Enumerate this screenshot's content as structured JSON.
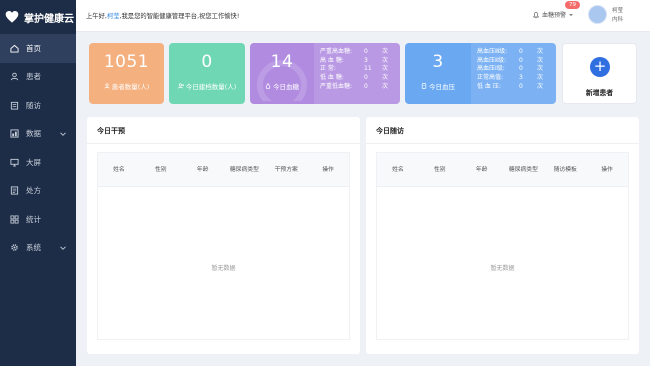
{
  "app": {
    "title": "掌护健康云"
  },
  "sidebar": {
    "items": [
      {
        "label": "首页",
        "icon": "home-icon",
        "expandable": false
      },
      {
        "label": "患者",
        "icon": "user-icon",
        "expandable": false
      },
      {
        "label": "随访",
        "icon": "clipboard-icon",
        "expandable": false
      },
      {
        "label": "数据",
        "icon": "data-icon",
        "expandable": true
      },
      {
        "label": "大屏",
        "icon": "monitor-icon",
        "expandable": false
      },
      {
        "label": "处方",
        "icon": "document-icon",
        "expandable": false
      },
      {
        "label": "统计",
        "icon": "grid-icon",
        "expandable": false
      },
      {
        "label": "系统",
        "icon": "gear-icon",
        "expandable": true
      }
    ],
    "active_index": 0
  },
  "header": {
    "greeting_prefix": "上午好,",
    "user_name": "柯莹",
    "greeting_suffix": ",我是您的智能健康管理平台,祝您工作愉快!",
    "alert_label": "血糖预警",
    "alert_count": "79",
    "user_short": "柯莹",
    "department": "内科"
  },
  "cards": {
    "patients": {
      "value": "1051",
      "label": "患者数量(人)",
      "color": "#f5b07f"
    },
    "archived_today": {
      "value": "0",
      "label": "今日建档数量(人)",
      "color": "#6fd7b4"
    },
    "glucose_today": {
      "value": "14",
      "label": "今日血糖",
      "color": "#b08be0",
      "stats": [
        {
          "label": "严重高血糖:",
          "value": "0",
          "unit": "次"
        },
        {
          "label": "高 血 糖:",
          "value": "3",
          "unit": "次"
        },
        {
          "label": "正 常:",
          "value": "11",
          "unit": "次"
        },
        {
          "label": "低 血 糖:",
          "value": "0",
          "unit": "次"
        },
        {
          "label": "严重低血糖:",
          "value": "0",
          "unit": "次"
        }
      ]
    },
    "bp_today": {
      "value": "3",
      "label": "今日血压",
      "color": "#6aa8f2",
      "stats": [
        {
          "label": "高血压Ⅲ级:",
          "value": "0",
          "unit": "次"
        },
        {
          "label": "高血压Ⅱ级:",
          "value": "0",
          "unit": "次"
        },
        {
          "label": "高血压Ⅰ级:",
          "value": "0",
          "unit": "次"
        },
        {
          "label": "正常高值:",
          "value": "3",
          "unit": "次"
        },
        {
          "label": "低 血 压:",
          "value": "0",
          "unit": "次"
        }
      ]
    },
    "add_patient": {
      "label": "新增患者"
    }
  },
  "intervention_panel": {
    "title": "今日干预",
    "columns": [
      "姓名",
      "性别",
      "年龄",
      "糖尿病类型",
      "干预方案",
      "操作"
    ],
    "empty_text": "暂无数据"
  },
  "followup_panel": {
    "title": "今日随访",
    "columns": [
      "姓名",
      "性别",
      "年龄",
      "糖尿病类型",
      "随访模板",
      "操作"
    ],
    "empty_text": "暂无数据"
  }
}
